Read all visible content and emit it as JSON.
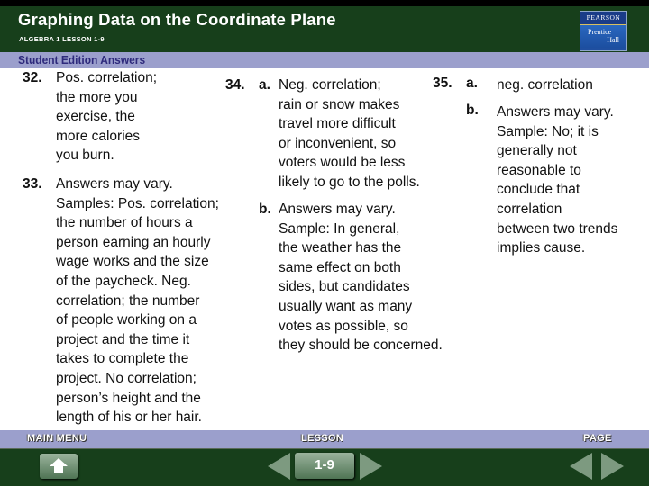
{
  "header": {
    "title": "Graphing Data on the Coordinate Plane",
    "subtitle": "ALGEBRA 1  LESSON 1-9",
    "logo": {
      "top": "PEARSON",
      "line1": "Prentice",
      "line2": "Hall"
    }
  },
  "section_label": "Student Edition Answers",
  "answers": {
    "q32": {
      "number": "32.",
      "lines": [
        "Pos. correlation;",
        "the more you",
        "exercise, the",
        "more calories",
        "you burn."
      ]
    },
    "q33": {
      "number": "33.",
      "lines": [
        "Answers may vary.",
        "Samples: Pos. correlation;",
        "the number of hours a",
        "person earning an hourly",
        "wage works and the size",
        "of the paycheck. Neg.",
        "correlation; the number",
        "of people working on a",
        "project and the time it",
        "takes to complete the",
        "project. No correlation;",
        "person’s height and the",
        "length of his or her hair."
      ]
    },
    "q34": {
      "number": "34.",
      "a": {
        "letter": "a.",
        "lines": [
          "Neg. correlation;",
          "rain or snow makes",
          "travel more difficult",
          "or inconvenient, so",
          "voters would be less",
          "likely to go to the polls."
        ]
      },
      "b": {
        "letter": "b.",
        "lines": [
          "Answers may vary.",
          "Sample: In general,",
          "the weather has the",
          "same effect on both",
          "sides, but candidates",
          "usually want as many",
          "votes as possible, so",
          "they should be concerned."
        ]
      }
    },
    "q35": {
      "number": "35.",
      "a": {
        "letter": "a.",
        "lines": [
          "neg. correlation"
        ]
      },
      "b": {
        "letter": "b.",
        "lines": [
          "Answers may vary.",
          "Sample: No; it is",
          "generally not",
          "reasonable to",
          "conclude that",
          "correlation",
          "between two trends",
          "implies cause."
        ]
      }
    }
  },
  "footer": {
    "main_menu_label": "MAIN MENU",
    "lesson_label": "LESSON",
    "page_label": "PAGE",
    "lesson_number": "1-9",
    "icons": {
      "home": "home-icon",
      "prev": "triangle-left-icon",
      "next": "triangle-right-icon"
    }
  },
  "colors": {
    "header_bg": "#173f1b",
    "band_bg": "#9b9fcc",
    "band_text": "#2e2a7c",
    "logo_blue": "#1f4fa0"
  }
}
